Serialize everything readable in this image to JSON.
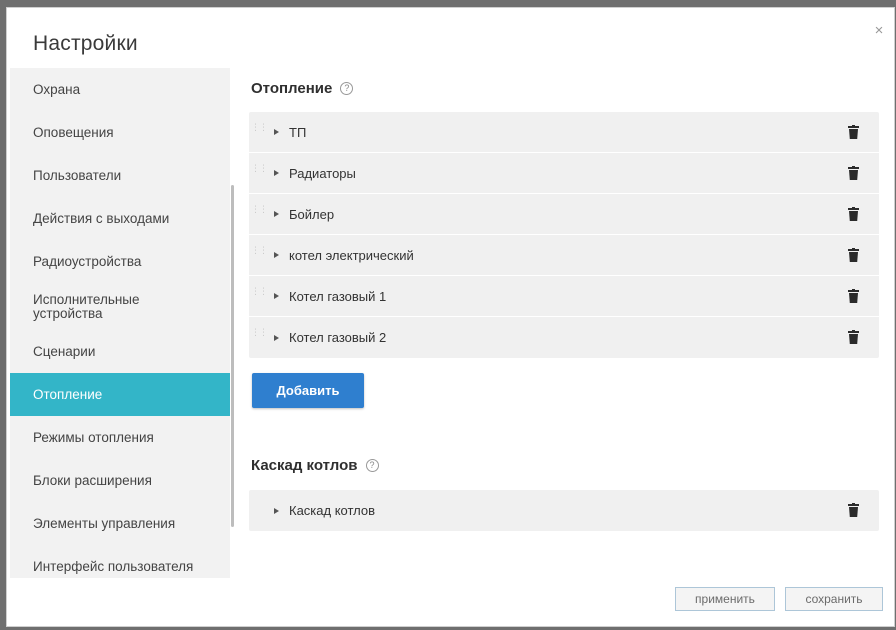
{
  "dialog": {
    "title": "Настройки",
    "close_glyph": "×"
  },
  "sidebar": {
    "active_color": "#33b5c8",
    "items": [
      {
        "label": "Охрана"
      },
      {
        "label": "Оповещения"
      },
      {
        "label": "Пользователи"
      },
      {
        "label": "Действия с выходами"
      },
      {
        "label": "Радиоустройства"
      },
      {
        "label": "Исполнительные устройства"
      },
      {
        "label": "Сценарии"
      },
      {
        "label": "Отопление",
        "active": true
      },
      {
        "label": "Режимы отопления"
      },
      {
        "label": "Блоки расширения"
      },
      {
        "label": "Элементы управления"
      },
      {
        "label": "Интерфейс пользователя"
      }
    ]
  },
  "heating": {
    "title": "Отопление",
    "help_glyph": "?",
    "items": [
      {
        "label": "ТП"
      },
      {
        "label": "Радиаторы"
      },
      {
        "label": "Бойлер"
      },
      {
        "label": "котел электрический"
      },
      {
        "label": "Котел газовый 1"
      },
      {
        "label": "Котел газовый 2"
      }
    ],
    "add_label": "Добавить",
    "add_color": "#2f7fcf"
  },
  "cascade": {
    "title": "Каскад котлов",
    "help_glyph": "?",
    "items": [
      {
        "label": "Каскад котлов"
      }
    ]
  },
  "footer": {
    "apply_label": "применить",
    "save_label": "сохранить"
  },
  "icons": {
    "row_expand": "caret-right-icon",
    "row_delete": "trash-icon",
    "row_drag": "drag-handle-icon",
    "help": "help-circle-icon",
    "close": "close-icon"
  }
}
